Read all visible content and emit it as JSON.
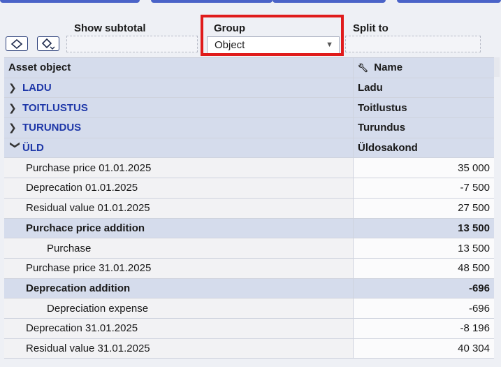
{
  "toolbar": {
    "show_subtotal_label": "Show subtotal",
    "group_label": "Group",
    "group_value": "Object",
    "split_to_label": "Split to",
    "expand_icon": "diamond-expand-icon",
    "collapse_icon": "diamond-collapse-icon"
  },
  "grid": {
    "headers": {
      "asset_object": "Asset object",
      "name": "Name"
    },
    "groups": [
      {
        "label": "LADU",
        "name": "Ladu",
        "expanded": false
      },
      {
        "label": "TOITLUSTUS",
        "name": "Toitlustus",
        "expanded": false
      },
      {
        "label": "TURUNDUS",
        "name": "Turundus",
        "expanded": false
      },
      {
        "label": "ÜLD",
        "name": "Üldosakond",
        "expanded": true
      }
    ],
    "detail_rows": [
      {
        "label": "Purchase price 01.01.2025",
        "value": "35 000"
      },
      {
        "label": "Deprecation 01.01.2025",
        "value": "-7 500"
      },
      {
        "label": "Residual value 01.01.2025",
        "value": "27 500"
      },
      {
        "label": "Purchace price addition",
        "value": "13 500"
      },
      {
        "label": "Purchase",
        "value": "13 500"
      },
      {
        "label": "Purchase price 31.01.2025",
        "value": "48 500"
      },
      {
        "label": "Deprecation addition",
        "value": "-696"
      },
      {
        "label": "Depreciation expense",
        "value": "-696"
      },
      {
        "label": "Deprecation 31.01.2025",
        "value": "-8 196"
      },
      {
        "label": "Residual value 31.01.2025",
        "value": "40 304"
      }
    ]
  },
  "colors": {
    "highlight": "#e01b1b",
    "group_text": "#1e37a8",
    "header_bg": "#d5dcec"
  }
}
